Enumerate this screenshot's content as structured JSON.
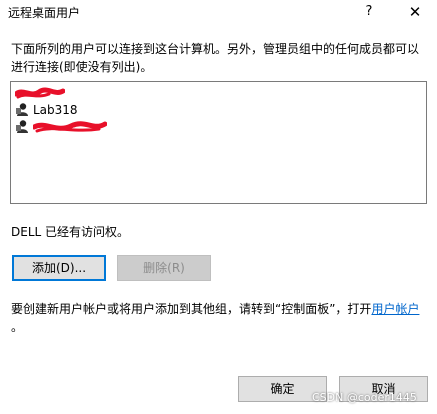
{
  "window": {
    "title": "远程桌面用户",
    "help_glyph": "?",
    "close_glyph": "✕"
  },
  "intro_text": "下面所列的用户可以连接到这台计算机。另外，管理员组中的任何成员都可以进行连接(即使没有列出)。",
  "user_list": {
    "items": [
      {
        "label": ""
      },
      {
        "label": "Lab318"
      },
      {
        "label": ""
      }
    ]
  },
  "access_text": "DELL 已经有访问权。",
  "buttons": {
    "add": "添加(D)...",
    "remove": "删除(R)",
    "ok": "确定",
    "cancel": "取消"
  },
  "hint": {
    "before": "要创建新用户帐户或将用户添加到其他组，请转到“控制面板”，打开",
    "link": "用户帐户",
    "after": "。"
  },
  "watermark": "CSDN @coder1445",
  "colors": {
    "accent": "#0078d7",
    "link": "#0066cc",
    "redaction": "#e8102a"
  }
}
